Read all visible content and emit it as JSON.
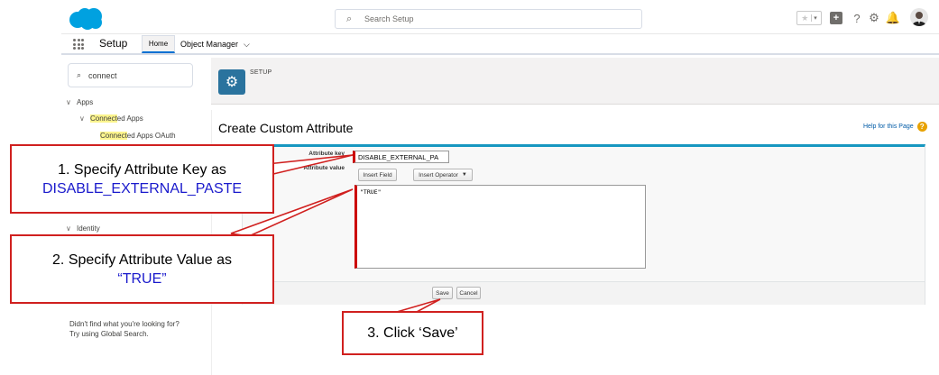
{
  "header": {
    "search_placeholder": "Search Setup"
  },
  "nav": {
    "app_name": "Setup",
    "tabs": [
      {
        "label": "Home"
      },
      {
        "label": "Object Manager"
      }
    ]
  },
  "sidebar": {
    "search_value": "connect",
    "tree": {
      "apps": "Apps",
      "connected_apps_hl": "Connect",
      "connected_apps_rest": "ed Apps",
      "oauth_hl": "Connect",
      "oauth_rest": "ed Apps OAuth",
      "identity": "Identity"
    },
    "help_line1": "Didn't find what you're looking for?",
    "help_line2": "Try using Global Search."
  },
  "page": {
    "breadcrumb": "SETUP",
    "title": "Create Custom Attribute",
    "help_link": "Help for this Page"
  },
  "form": {
    "key_label": "Attribute key",
    "key_value": "DISABLE_EXTERNAL_PA",
    "value_label": "Attribute value",
    "insert_field": "Insert Field",
    "insert_operator": "Insert Operator",
    "value_text": "\"TRUE\"",
    "save": "Save",
    "cancel": "Cancel"
  },
  "callouts": {
    "step1_line1": "1. Specify Attribute Key as",
    "step1_line2": "DISABLE_EXTERNAL_PASTE",
    "step2_line1": "2. Specify Attribute Value as",
    "step2_line2": "“TRUE”",
    "step3": "3. Click ‘Save’"
  },
  "colors": {
    "brand_blue": "#00a1e0",
    "callout_red": "#d0201f",
    "callout_text_blue": "#1a1acc",
    "highlight": "#fcf48d"
  },
  "icons": [
    "salesforce-cloud-logo",
    "search-icon",
    "star-icon",
    "plus-icon",
    "help-icon",
    "gear-icon",
    "bell-icon",
    "app-launcher-icon",
    "chevron-down-icon",
    "setup-gear-icon"
  ]
}
